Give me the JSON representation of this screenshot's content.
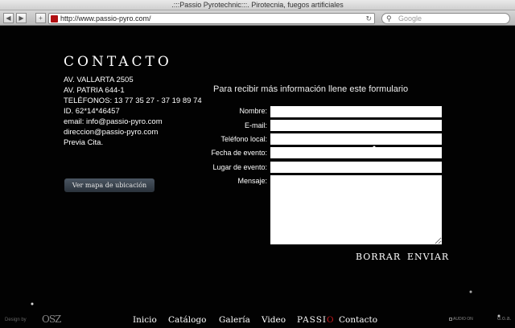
{
  "browser": {
    "title": ".:::Passio Pyrotechnic:::. Pirotecnia, fuegos artificiales",
    "url": "http://www.passio-pyro.com/",
    "search_placeholder": "Google",
    "back_glyph": "◀",
    "forward_glyph": "▶",
    "add_glyph": "+",
    "reload_glyph": "↻",
    "search_glyph": "⚲"
  },
  "contact": {
    "heading": "CONTACTO",
    "lines": [
      "AV. VALLARTA 2505",
      "AV. PATRIA 644-1",
      "TELÉFONOS: 13 77 35 27 - 37 19 89 74",
      "ID. 62*14*46457",
      "email: info@passio-pyro.com",
      "direccion@passio-pyro.com",
      "Previa Cita."
    ],
    "map_button": "Ver mapa de ubicación"
  },
  "form": {
    "title": "Para recibir más información llene este formulario",
    "labels": {
      "name": "Nombre:",
      "email": "E-mail:",
      "phone": "Teléfono local:",
      "date": "Fecha de evento:",
      "place": "Lugar de evento:",
      "message": "Mensaje:"
    },
    "reset": "BORRAR",
    "submit": "ENVIAR"
  },
  "footer": {
    "nav": [
      "Inicio",
      "Catálogo",
      "Galería",
      "Video"
    ],
    "brand_a": "PASSI",
    "brand_b": "O",
    "contact": "Contacto",
    "design_by": "Design by",
    "design_logo": "OSZ",
    "audio": "AUDIO ON",
    "dots": "d.o.a."
  }
}
